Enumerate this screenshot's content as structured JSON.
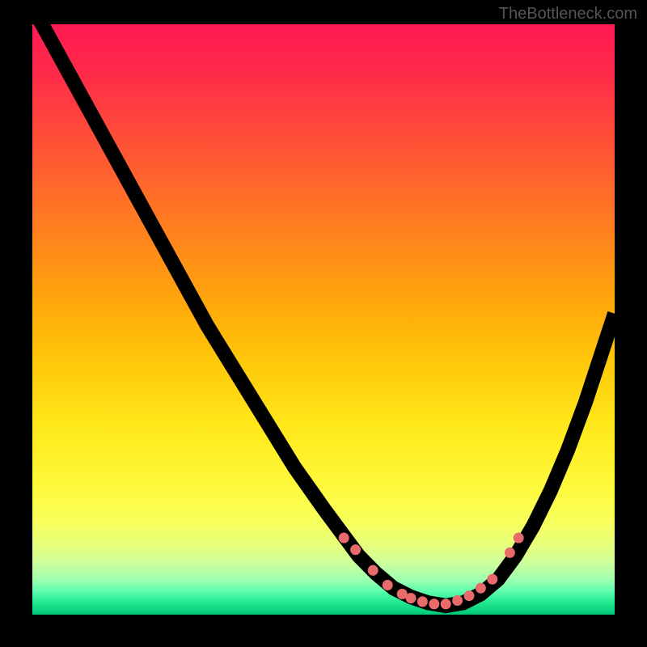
{
  "watermark": "TheBottleneck.com",
  "chart_data": {
    "type": "line",
    "xlim": [
      0,
      100
    ],
    "ylim": [
      0,
      100
    ],
    "curve": {
      "x": [
        0,
        5,
        10,
        15,
        20,
        25,
        30,
        35,
        40,
        45,
        50,
        53,
        56,
        59,
        62,
        65,
        68,
        71,
        74,
        77,
        80,
        83,
        86,
        89,
        92,
        95,
        98,
        100
      ],
      "y": [
        103,
        94,
        85,
        76,
        67,
        58,
        49,
        41,
        33,
        25,
        18,
        14,
        10,
        7,
        4.5,
        3,
        2,
        1.5,
        2,
        3.5,
        6,
        10,
        15,
        21,
        28,
        36,
        45,
        51
      ]
    },
    "dots": {
      "x": [
        53.5,
        55.5,
        58.5,
        61,
        63.5,
        65,
        67,
        69,
        71,
        73,
        75,
        77,
        79,
        82,
        83.5
      ],
      "y": [
        13,
        11,
        7.5,
        5,
        3.5,
        2.8,
        2.2,
        1.8,
        1.8,
        2.4,
        3.2,
        4.5,
        6,
        10.5,
        13
      ]
    }
  }
}
